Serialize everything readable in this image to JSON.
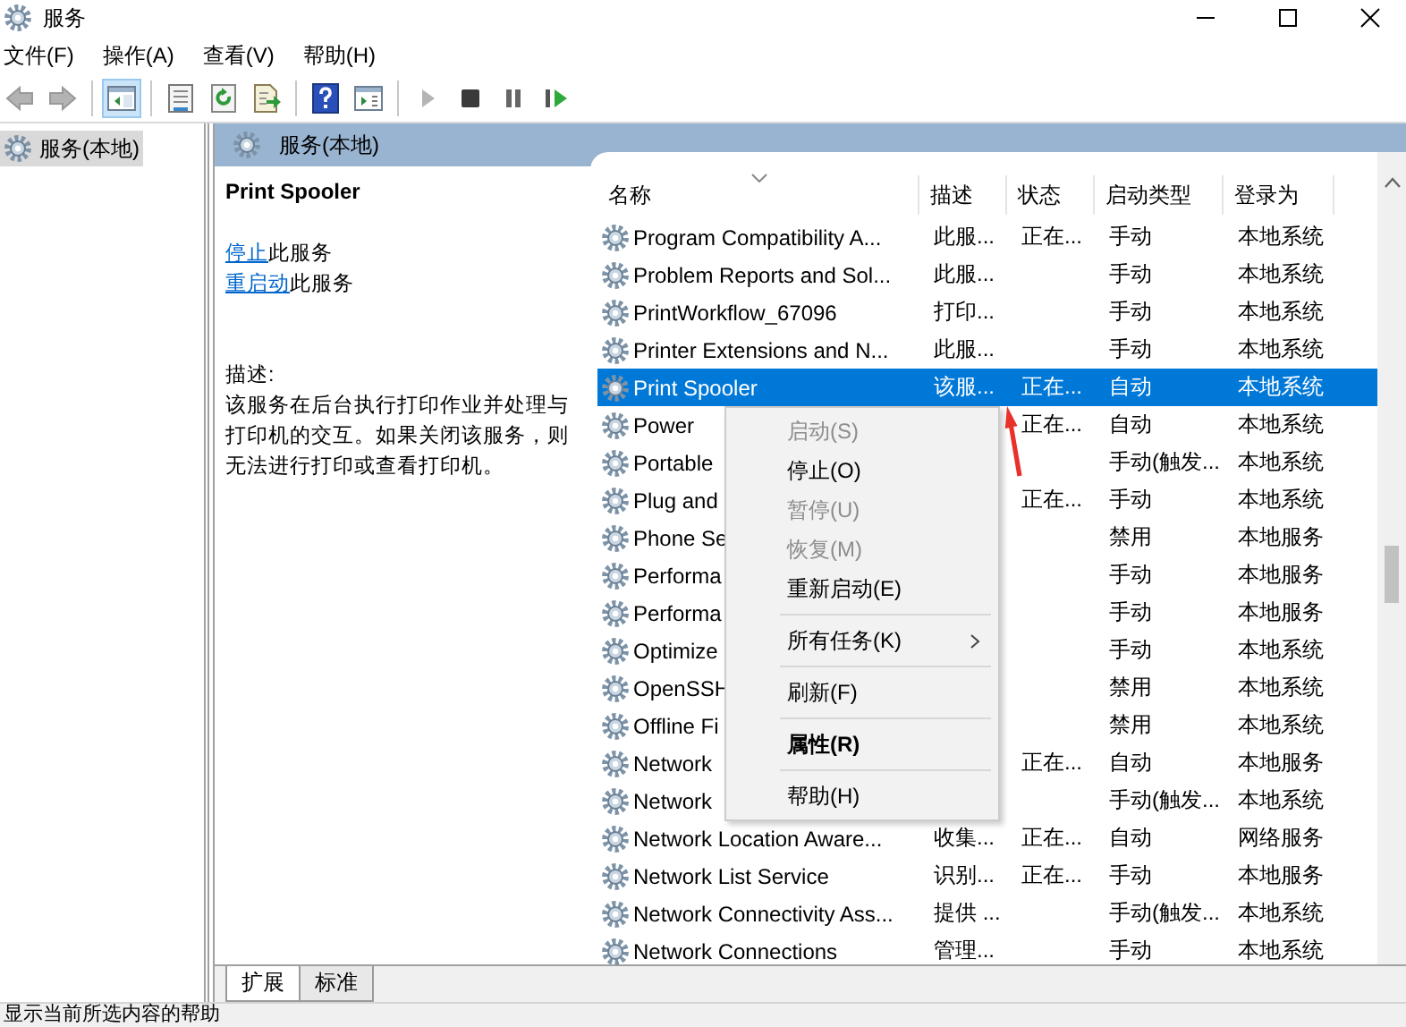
{
  "window": {
    "title": "服务"
  },
  "menu": [
    "文件(F)",
    "操作(A)",
    "查看(V)",
    "帮助(H)"
  ],
  "toolbar": [
    {
      "kind": "back",
      "disabled": true,
      "pressed": false
    },
    {
      "kind": "forward",
      "disabled": true,
      "pressed": false
    },
    {
      "kind": "sep"
    },
    {
      "kind": "tree",
      "disabled": false,
      "pressed": true
    },
    {
      "kind": "sep"
    },
    {
      "kind": "properties",
      "disabled": false,
      "pressed": false
    },
    {
      "kind": "refresh",
      "disabled": false,
      "pressed": false
    },
    {
      "kind": "export",
      "disabled": false,
      "pressed": false
    },
    {
      "kind": "sep"
    },
    {
      "kind": "help",
      "disabled": false,
      "pressed": false
    },
    {
      "kind": "console",
      "disabled": false,
      "pressed": false
    },
    {
      "kind": "sep"
    },
    {
      "kind": "play",
      "disabled": true,
      "pressed": false
    },
    {
      "kind": "stop",
      "disabled": false,
      "pressed": false
    },
    {
      "kind": "pause",
      "disabled": false,
      "pressed": false
    },
    {
      "kind": "resume",
      "disabled": false,
      "pressed": false
    }
  ],
  "tree": {
    "items": [
      {
        "label": "服务(本地)",
        "selected": true
      }
    ]
  },
  "panel_header": "服务(本地)",
  "details": {
    "title": "Print Spooler",
    "actions": [
      {
        "link": "停止",
        "text": "此服务"
      },
      {
        "link": "重启动",
        "text": "此服务"
      }
    ],
    "description_label": "描述:",
    "description": "该服务在后台执行打印作业并处理与打印机的交互。如果关闭该服务，则无法进行打印或查看打印机。"
  },
  "table": {
    "columns": [
      "名称",
      "描述",
      "状态",
      "启动类型",
      "登录为"
    ],
    "rows": [
      {
        "name": "Program Compatibility A...",
        "description": "此服...",
        "status": "正在...",
        "startup": "手动",
        "logon": "本地系统",
        "selected": false
      },
      {
        "name": "Problem Reports and Sol...",
        "description": "此服...",
        "status": "",
        "startup": "手动",
        "logon": "本地系统",
        "selected": false
      },
      {
        "name": "PrintWorkflow_67096",
        "description": "打印...",
        "status": "",
        "startup": "手动",
        "logon": "本地系统",
        "selected": false
      },
      {
        "name": "Printer Extensions and N...",
        "description": "此服...",
        "status": "",
        "startup": "手动",
        "logon": "本地系统",
        "selected": false
      },
      {
        "name": "Print Spooler",
        "description": "该服...",
        "status": "正在...",
        "startup": "自动",
        "logon": "本地系统",
        "selected": true
      },
      {
        "name": "Power",
        "description": "",
        "status": "正在...",
        "startup": "自动",
        "logon": "本地系统",
        "selected": false
      },
      {
        "name": "Portable",
        "description": "",
        "status": "",
        "startup": "手动(触发...",
        "logon": "本地系统",
        "selected": false
      },
      {
        "name": "Plug and",
        "description": "",
        "status": "正在...",
        "startup": "手动",
        "logon": "本地系统",
        "selected": false
      },
      {
        "name": "Phone Se",
        "description": "",
        "status": "",
        "startup": "禁用",
        "logon": "本地服务",
        "selected": false
      },
      {
        "name": "Performa",
        "description": "",
        "status": "",
        "startup": "手动",
        "logon": "本地服务",
        "selected": false
      },
      {
        "name": "Performa",
        "description": "",
        "status": "",
        "startup": "手动",
        "logon": "本地服务",
        "selected": false
      },
      {
        "name": "Optimize",
        "description": "",
        "status": "",
        "startup": "手动",
        "logon": "本地系统",
        "selected": false
      },
      {
        "name": "OpenSSH",
        "description": "",
        "status": "",
        "startup": "禁用",
        "logon": "本地系统",
        "selected": false
      },
      {
        "name": "Offline Fi",
        "description": "",
        "status": "",
        "startup": "禁用",
        "logon": "本地系统",
        "selected": false
      },
      {
        "name": "Network",
        "description": "",
        "status": "正在...",
        "startup": "自动",
        "logon": "本地服务",
        "selected": false
      },
      {
        "name": "Network",
        "description": "",
        "status": "",
        "startup": "手动(触发...",
        "logon": "本地系统",
        "selected": false
      },
      {
        "name": "Network Location Aware...",
        "description": "收集...",
        "status": "正在...",
        "startup": "自动",
        "logon": "网络服务",
        "selected": false
      },
      {
        "name": "Network List Service",
        "description": "识别...",
        "status": "正在...",
        "startup": "手动",
        "logon": "本地服务",
        "selected": false
      },
      {
        "name": "Network Connectivity Ass...",
        "description": "提供 ...",
        "status": "",
        "startup": "手动(触发...",
        "logon": "本地系统",
        "selected": false
      },
      {
        "name": "Network Connections",
        "description": "管理...",
        "status": "",
        "startup": "手动",
        "logon": "本地系统",
        "selected": false
      }
    ]
  },
  "tabs": [
    {
      "label": "扩展",
      "selected": true
    },
    {
      "label": "标准",
      "selected": false
    }
  ],
  "context_menu": {
    "groups": [
      [
        {
          "label": "启动(S)",
          "disabled": true,
          "kind": "item"
        },
        {
          "label": "停止(O)",
          "disabled": false,
          "kind": "item"
        },
        {
          "label": "暂停(U)",
          "disabled": true,
          "kind": "item"
        },
        {
          "label": "恢复(M)",
          "disabled": true,
          "kind": "item"
        },
        {
          "label": "重新启动(E)",
          "disabled": false,
          "kind": "item"
        }
      ],
      [
        {
          "label": "所有任务(K)",
          "disabled": false,
          "kind": "submenu"
        }
      ],
      [
        {
          "label": "刷新(F)",
          "disabled": false,
          "kind": "item"
        }
      ],
      [
        {
          "label": "属性(R)",
          "disabled": false,
          "kind": "default"
        }
      ],
      [
        {
          "label": "帮助(H)",
          "disabled": false,
          "kind": "item"
        }
      ]
    ]
  },
  "status_bar": "显示当前所选内容的帮助"
}
